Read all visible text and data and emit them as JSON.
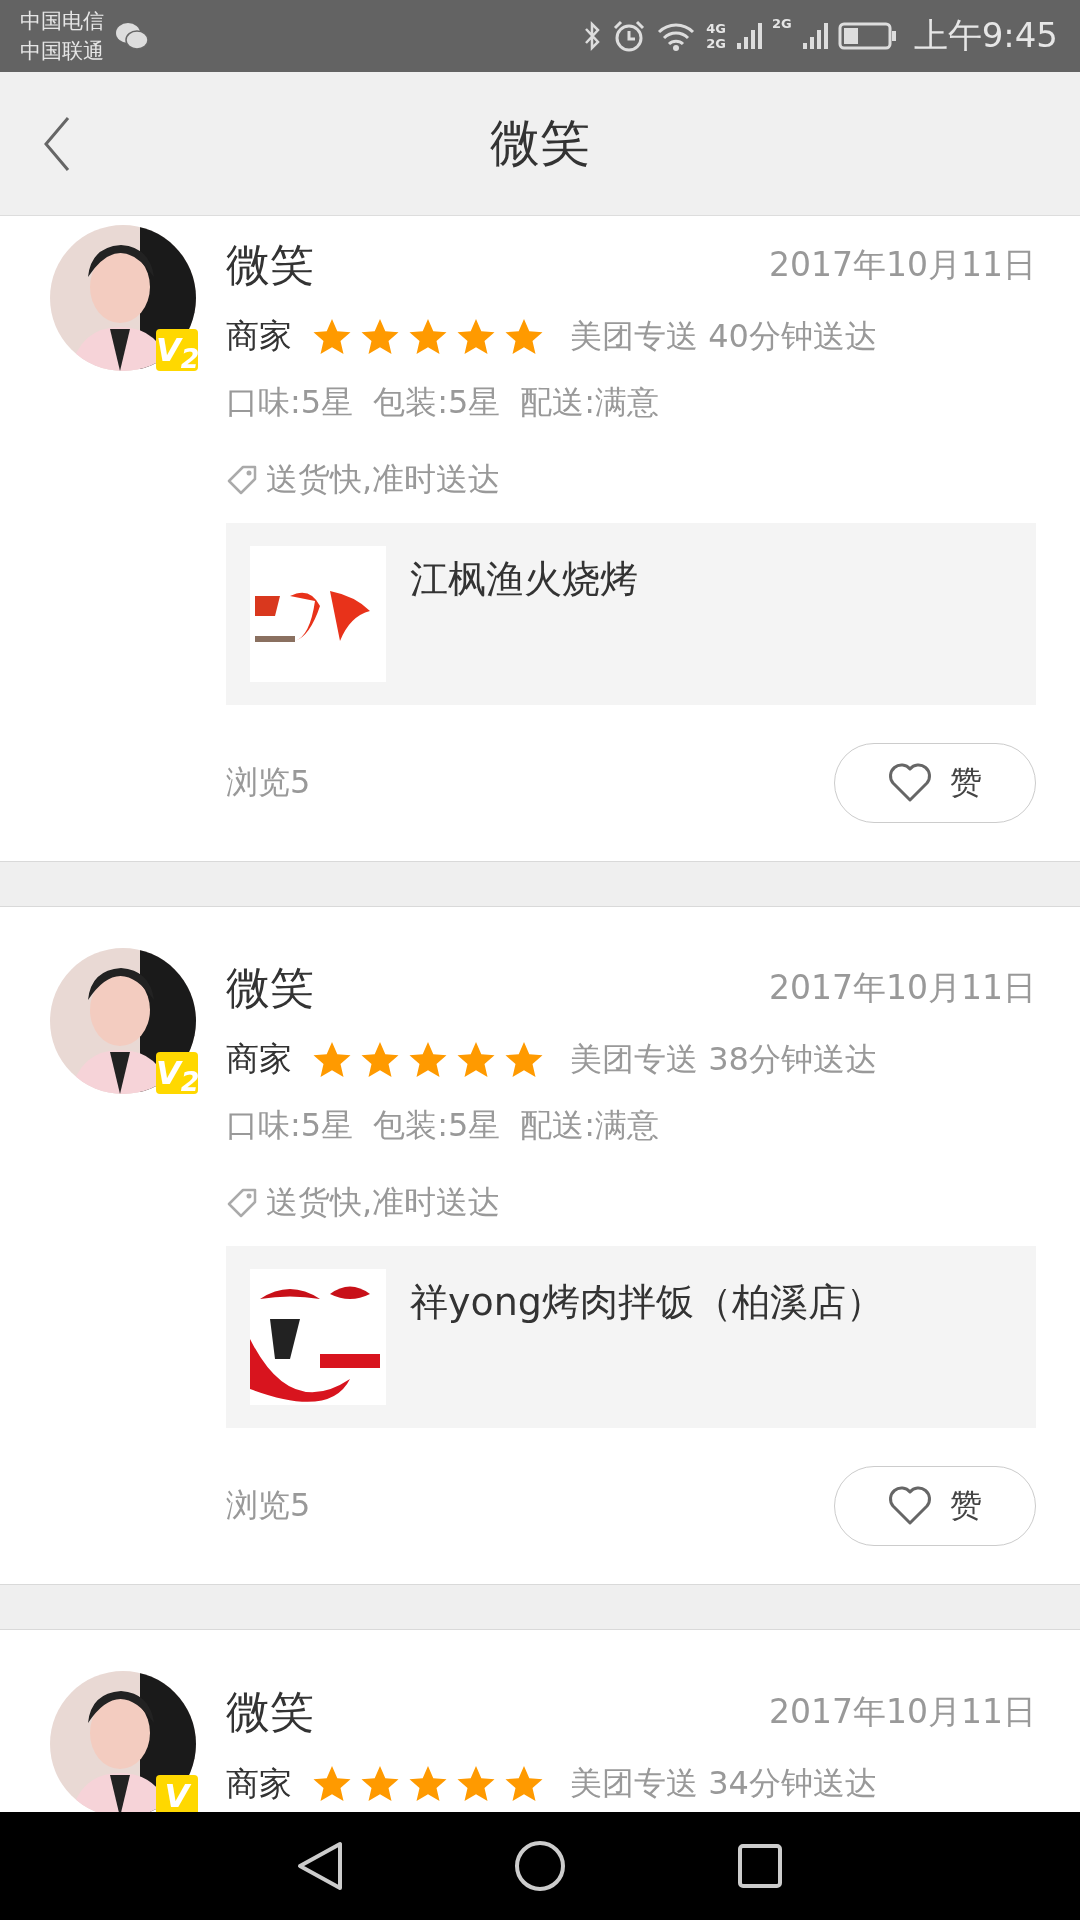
{
  "status_bar": {
    "carriers": [
      "中国电信",
      "中国联通"
    ],
    "network_1": [
      "4G",
      "2G"
    ],
    "network_2": "2G",
    "time": "上午9:45"
  },
  "header": {
    "title": "微笑"
  },
  "reviews": [
    {
      "user": "微笑",
      "badge": "V$_{2}$",
      "date": "2017年10月11日",
      "role": "商家",
      "stars": 5,
      "delivery": "美团专送 40分钟送达",
      "scores": [
        "口味:5星",
        "包装:5星",
        "配送:满意"
      ],
      "tags": "送货快,准时送达",
      "shop": {
        "name": "江枫渔火烧烤",
        "kind": "picture"
      },
      "views": "浏览5",
      "like": "赞"
    },
    {
      "user": "微笑",
      "badge": "V$_{2}$",
      "date": "2017年10月11日",
      "role": "商家",
      "stars": 5,
      "delivery": "美团专送 38分钟送达",
      "scores": [
        "口味:5星",
        "包装:5星",
        "配送:满意"
      ],
      "tags": "送货快,准时送达",
      "shop": {
        "name": "祥yong烤肉拌饭（柏溪店）",
        "kind": "picture"
      },
      "views": "浏览5",
      "like": "赞"
    },
    {
      "user": "微笑",
      "badge": "V",
      "date": "2017年10月11日",
      "role": "商家",
      "stars": 5,
      "delivery": "美团专送 34分钟送达"
    }
  ]
}
